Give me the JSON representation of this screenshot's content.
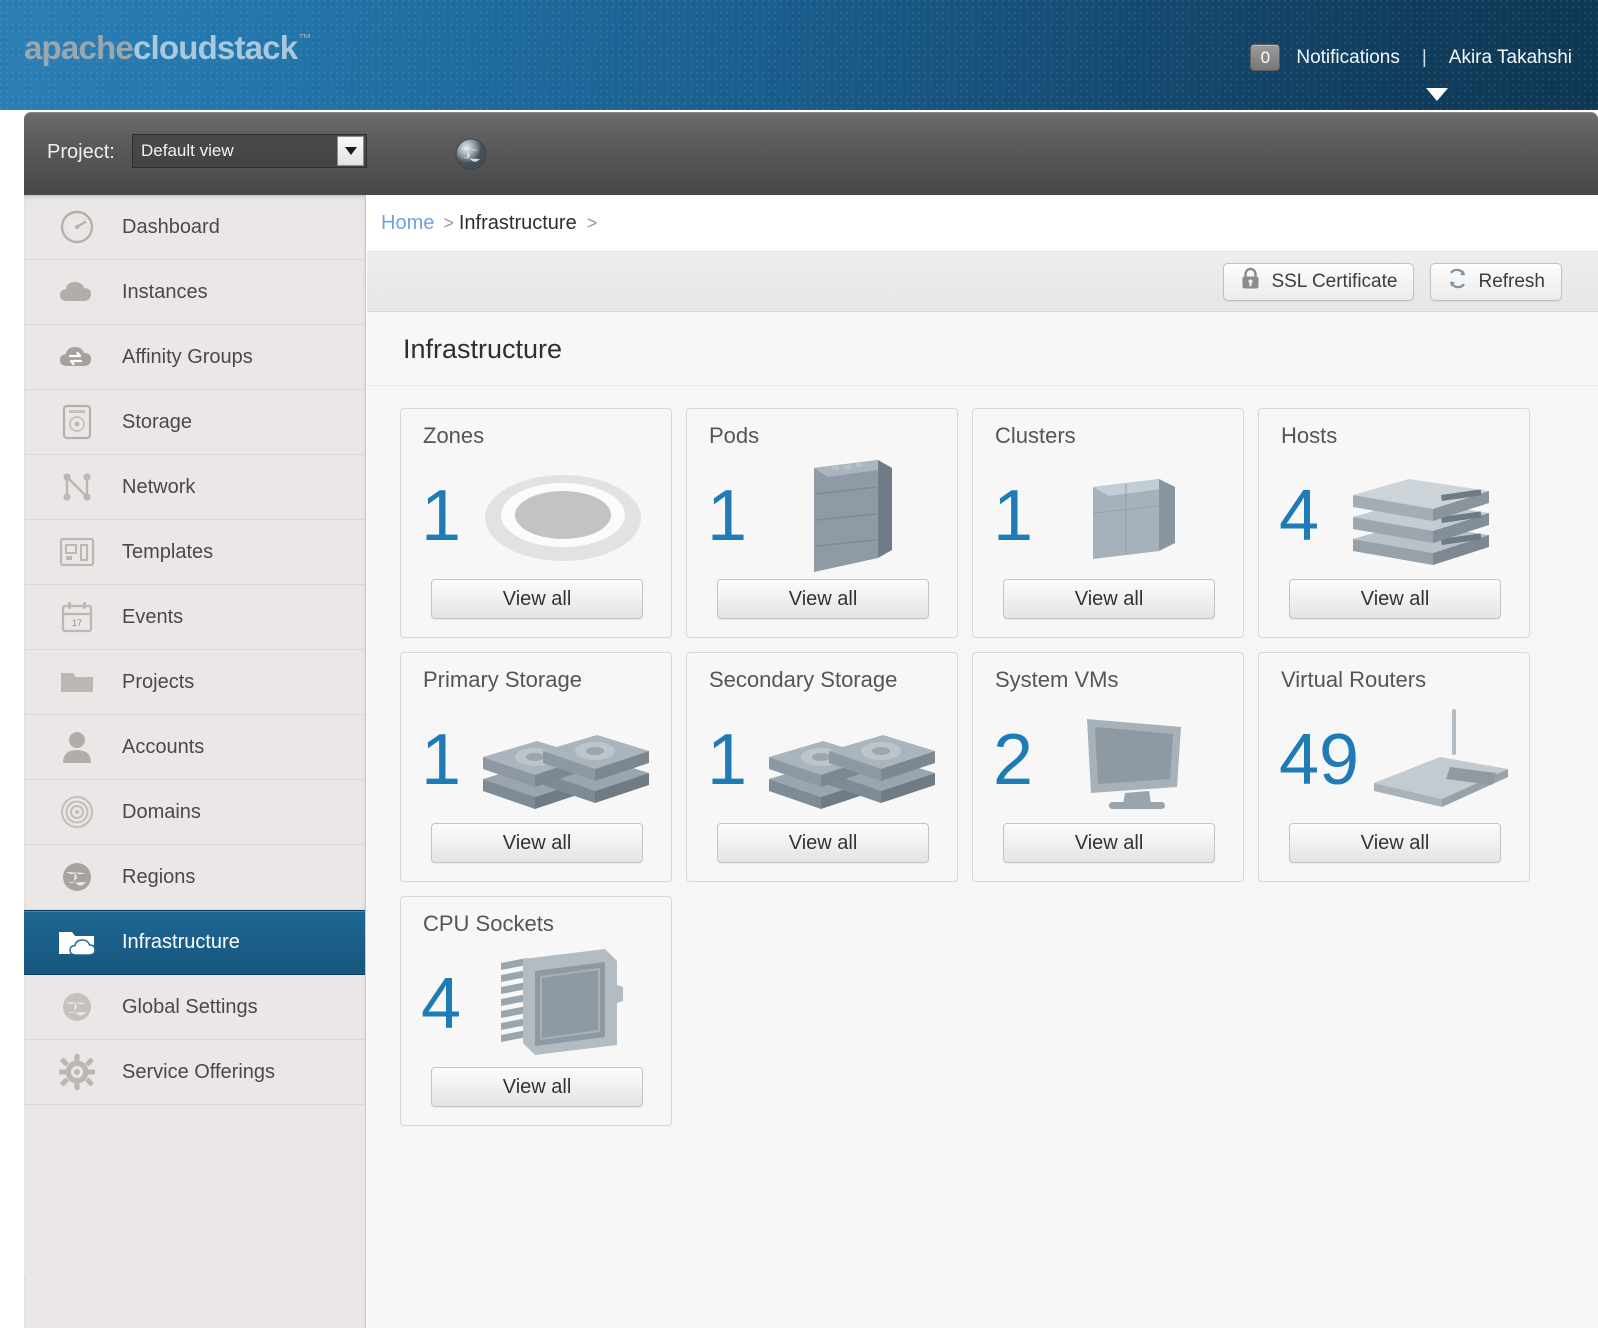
{
  "header": {
    "logo_part1": "apache",
    "logo_part2": "cloudstack",
    "logo_tm": "™",
    "notifications_count": "0",
    "notifications_label": "Notifications",
    "separator": "|",
    "user_name": "Akira Takahshi"
  },
  "projectbar": {
    "label": "Project:",
    "selected_value": "Default view",
    "globe_icon": "globe-icon"
  },
  "sidebar": {
    "items": [
      {
        "label": "Dashboard",
        "icon": "gauge-icon",
        "active": false
      },
      {
        "label": "Instances",
        "icon": "cloud-icon",
        "active": false
      },
      {
        "label": "Affinity Groups",
        "icon": "cloud-swap-icon",
        "active": false
      },
      {
        "label": "Storage",
        "icon": "hard-drive-icon",
        "active": false
      },
      {
        "label": "Network",
        "icon": "network-nodes-icon",
        "active": false
      },
      {
        "label": "Templates",
        "icon": "templates-icon",
        "active": false
      },
      {
        "label": "Events",
        "icon": "calendar-icon",
        "active": false
      },
      {
        "label": "Projects",
        "icon": "folder-icon",
        "active": false
      },
      {
        "label": "Accounts",
        "icon": "user-icon",
        "active": false
      },
      {
        "label": "Domains",
        "icon": "target-icon",
        "active": false
      },
      {
        "label": "Regions",
        "icon": "globe-icon",
        "active": false
      },
      {
        "label": "Infrastructure",
        "icon": "folder-cloud-icon",
        "active": true
      },
      {
        "label": "Global Settings",
        "icon": "globe-gray-icon",
        "active": false
      },
      {
        "label": "Service Offerings",
        "icon": "gear-icon",
        "active": false
      }
    ]
  },
  "breadcrumb": {
    "home": "Home",
    "sep": ">",
    "current": "Infrastructure",
    "trailing_sep": ">"
  },
  "toolbar": {
    "ssl_label": "SSL Certificate",
    "ssl_icon": "lock-icon",
    "refresh_label": "Refresh",
    "refresh_icon": "refresh-icon"
  },
  "panel": {
    "title": "Infrastructure",
    "view_all_label": "View all",
    "cards": [
      {
        "title": "Zones",
        "count": "1",
        "art": "zone-disc-icon"
      },
      {
        "title": "Pods",
        "count": "1",
        "art": "pod-rack-icon"
      },
      {
        "title": "Clusters",
        "count": "1",
        "art": "cluster-cube-icon"
      },
      {
        "title": "Hosts",
        "count": "4",
        "art": "host-servers-icon"
      },
      {
        "title": "Primary Storage",
        "count": "1",
        "art": "storage-stack-icon"
      },
      {
        "title": "Secondary Storage",
        "count": "1",
        "art": "storage-stack-icon"
      },
      {
        "title": "System VMs",
        "count": "2",
        "art": "monitor-icon"
      },
      {
        "title": "Virtual Routers",
        "count": "49",
        "art": "router-icon"
      },
      {
        "title": "CPU Sockets",
        "count": "4",
        "art": "cpu-chip-icon"
      }
    ]
  },
  "colors": {
    "accent_blue": "#1f7bb6",
    "header_blue_light": "#2b7fb5",
    "header_blue_dark": "#0e3753",
    "sidebar_bg": "#eae7e6",
    "active_nav": "#1e6794",
    "link_blue": "#6ba4e0"
  }
}
